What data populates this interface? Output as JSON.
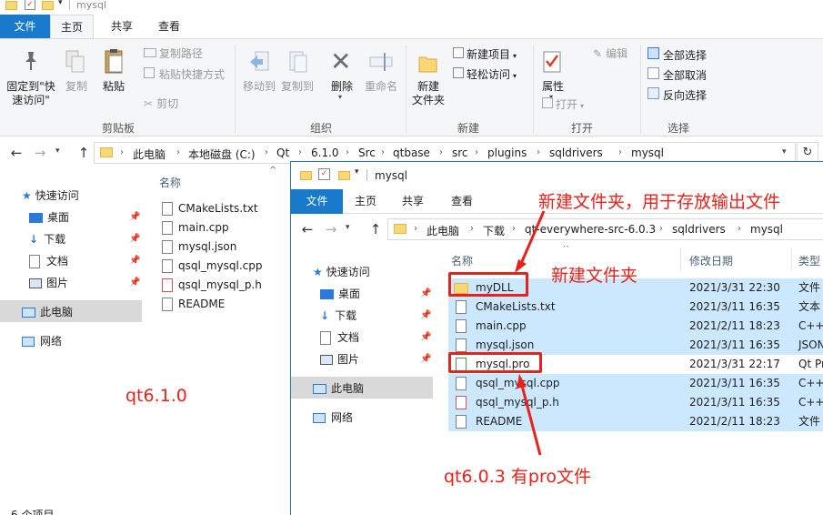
{
  "window1": {
    "title": "mysql",
    "tabs": [
      "文件",
      "主页",
      "共享",
      "查看"
    ],
    "ribbon": {
      "clipboard": {
        "pin": "固定到\"快\n速访问\"",
        "copy": "复制",
        "paste": "粘贴",
        "copy_path": "复制路径",
        "paste_shortcut": "粘贴快捷方式",
        "cut": "剪切",
        "group": "剪贴板"
      },
      "organize": {
        "move_to": "移动到",
        "copy_to": "复制到",
        "delete": "删除",
        "rename": "重命名",
        "group": "组织"
      },
      "new": {
        "new_folder": "新建\n文件夹",
        "new_item": "新建项目",
        "easy_access": "轻松访问",
        "group": "新建"
      },
      "open": {
        "properties": "属性",
        "open": "打开",
        "edit": "编辑",
        "group": "打开"
      },
      "select": {
        "select_all": "全部选择",
        "select_none": "全部取消",
        "invert": "反向选择",
        "group": "选择"
      }
    },
    "breadcrumb": [
      "此电脑",
      "本地磁盘 (C:)",
      "Qt",
      "6.1.0",
      "Src",
      "qtbase",
      "src",
      "plugins",
      "sqldrivers",
      "mysql"
    ],
    "nav": {
      "quick_access": "快速访问",
      "desktop": "桌面",
      "downloads": "下载",
      "documents": "文档",
      "pictures": "图片",
      "this_pc": "此电脑",
      "network": "网络"
    },
    "column_name": "名称",
    "files": [
      "CMakeLists.txt",
      "main.cpp",
      "mysql.json",
      "qsql_mysql.cpp",
      "qsql_mysql_p.h",
      "README"
    ],
    "status": "6 个项目"
  },
  "window2": {
    "title": "mysql",
    "tabs": [
      "文件",
      "主页",
      "共享",
      "查看"
    ],
    "breadcrumb": [
      "此电脑",
      "下载",
      "qt-everywhere-src-6.0.3",
      "sqldrivers",
      "mysql"
    ],
    "nav": {
      "quick_access": "快速访问",
      "desktop": "桌面",
      "downloads": "下载",
      "documents": "文档",
      "pictures": "图片",
      "this_pc": "此电脑",
      "network": "网络"
    },
    "columns": {
      "name": "名称",
      "date": "修改日期",
      "type": "类型"
    },
    "files": [
      {
        "name": "myDLL",
        "date": "2021/3/31 22:30",
        "type": "文件"
      },
      {
        "name": "CMakeLists.txt",
        "date": "2021/3/11 16:35",
        "type": "文本"
      },
      {
        "name": "main.cpp",
        "date": "2021/2/11 18:23",
        "type": "C++"
      },
      {
        "name": "mysql.json",
        "date": "2021/3/11 16:35",
        "type": "JSON"
      },
      {
        "name": "mysql.pro",
        "date": "2021/3/31 22:17",
        "type": "Qt Pro"
      },
      {
        "name": "qsql_mysql.cpp",
        "date": "2021/3/11 16:35",
        "type": "C++"
      },
      {
        "name": "qsql_mysql_p.h",
        "date": "2021/3/11 16:35",
        "type": "C++"
      },
      {
        "name": "README",
        "date": "2021/2/11 18:23",
        "type": "文件"
      }
    ]
  },
  "annotations": {
    "top": "新建文件夹，用于存放输出文件",
    "folder": "新建文件夹",
    "qt610": "qt6.1.0",
    "qt603": "qt6.0.3 有pro文件"
  },
  "colors": {
    "accent": "#1979ca",
    "selection": "#cce8ff",
    "annotation": "#e8221b"
  }
}
